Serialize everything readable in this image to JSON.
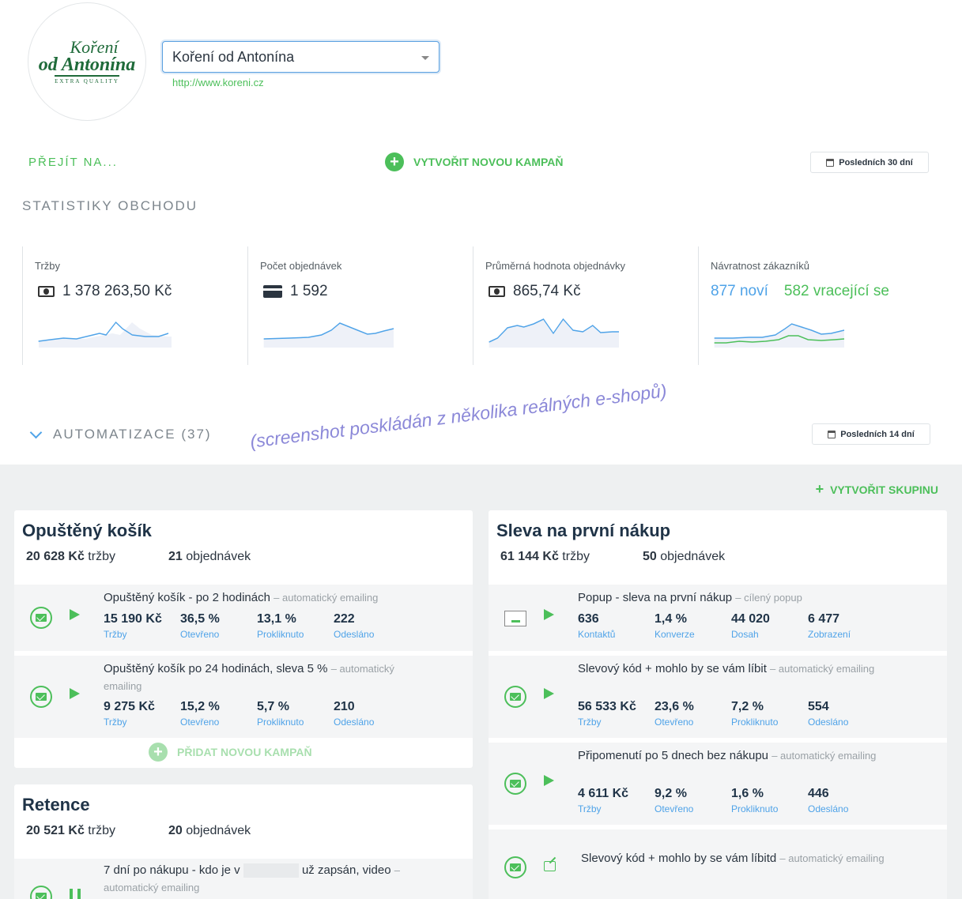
{
  "shop": {
    "logo": {
      "line1": "Koření",
      "line2": "od Antonína",
      "line3": "EXTRA QUALITY"
    },
    "selected": "Koření od Antonína",
    "url": "http://www.koreni.cz"
  },
  "toolbar": {
    "goto_label": "PŘEJÍT NA...",
    "new_campaign_label": "VYTVOŘIT NOVOU KAMPAŇ",
    "period_label": "Posledních 30 dní"
  },
  "stats": {
    "title": "STATISTIKY OBCHODU",
    "revenue": {
      "label": "Tržby",
      "value": "1 378 263,50 Kč",
      "icon": "money-icon"
    },
    "orders": {
      "label": "Počet objednávek",
      "value": "1 592",
      "icon": "credit-card-icon"
    },
    "avg_order": {
      "label": "Průměrná hodnota objednávky",
      "value": "865,74 Kč",
      "icon": "money-icon"
    },
    "returning": {
      "label": "Návratnost zákazníků",
      "new_value": "877 noví",
      "returning_value": "582 vracející se"
    }
  },
  "automation": {
    "title": "AUTOMATIZACE (37)",
    "period_label": "Posledních 14 dní",
    "create_group_label": "VYTVOŘIT SKUPINU"
  },
  "watermark": "(screenshot poskládán z několika reálných e-shopů)",
  "groups": {
    "abandoned_cart": {
      "title": "Opuštěný košík",
      "revenue": "20 628 Kč",
      "revenue_label": "tržby",
      "orders": "21",
      "orders_label": "objednávek",
      "add_label": "PŘIDAT NOVOU KAMPAŇ",
      "campaigns": [
        {
          "name": "Opuštěný košík - po 2 hodinách",
          "tag": "– automatický emailing",
          "metrics": [
            {
              "v": "15 190 Kč",
              "l": "Tržby"
            },
            {
              "v": "36,5 %",
              "l": "Otevřeno"
            },
            {
              "v": "13,1 %",
              "l": "Prokliknuto"
            },
            {
              "v": "222",
              "l": "Odesláno"
            }
          ]
        },
        {
          "name": "Opuštěný košík po 24 hodinách, sleva 5 %",
          "tag": "– automatický emailing",
          "metrics": [
            {
              "v": "9 275 Kč",
              "l": "Tržby"
            },
            {
              "v": "15,2 %",
              "l": "Otevřeno"
            },
            {
              "v": "5,7 %",
              "l": "Prokliknuto"
            },
            {
              "v": "210",
              "l": "Odesláno"
            }
          ]
        }
      ]
    },
    "retention": {
      "title": "Retence",
      "revenue": "20 521 Kč",
      "revenue_label": "tržby",
      "orders": "20",
      "orders_label": "objednávek",
      "campaigns": [
        {
          "name_start": "7 dní po nákupu - kdo je v",
          "name_end": "už zapsán, video",
          "tag": "– automatický emailing"
        }
      ]
    },
    "first_purchase": {
      "title": "Sleva na první nákup",
      "revenue": "61 144 Kč",
      "revenue_label": "tržby",
      "orders": "50",
      "orders_label": "objednávek",
      "campaigns": [
        {
          "name": "Popup - sleva na první nákup",
          "tag": "– cílený popup",
          "metrics": [
            {
              "v": "636",
              "l": "Kontaktů"
            },
            {
              "v": "1,4 %",
              "l": "Konverze"
            },
            {
              "v": "44 020",
              "l": "Dosah"
            },
            {
              "v": "6 477",
              "l": "Zobrazení"
            }
          ]
        },
        {
          "name": "Slevový kód + mohlo by se vám líbit",
          "tag": "– automatický emailing",
          "metrics": [
            {
              "v": "56 533 Kč",
              "l": "Tržby"
            },
            {
              "v": "23,6 %",
              "l": "Otevřeno"
            },
            {
              "v": "7,2 %",
              "l": "Prokliknuto"
            },
            {
              "v": "554",
              "l": "Odesláno"
            }
          ]
        },
        {
          "name": "Připomenutí po 5 dnech bez nákupu",
          "tag": "– automatický emailing",
          "metrics": [
            {
              "v": "4 611 Kč",
              "l": "Tržby"
            },
            {
              "v": "9,2 %",
              "l": "Otevřeno"
            },
            {
              "v": "1,6 %",
              "l": "Prokliknuto"
            },
            {
              "v": "446",
              "l": "Odesláno"
            }
          ]
        },
        {
          "name": "Slevový kód + mohlo by se vám líbitd",
          "tag": "– automatický emailing"
        }
      ]
    }
  },
  "colors": {
    "accent_green": "#4cbf5a",
    "accent_blue": "#4fa3e8",
    "title_navy": "#1f3347"
  }
}
